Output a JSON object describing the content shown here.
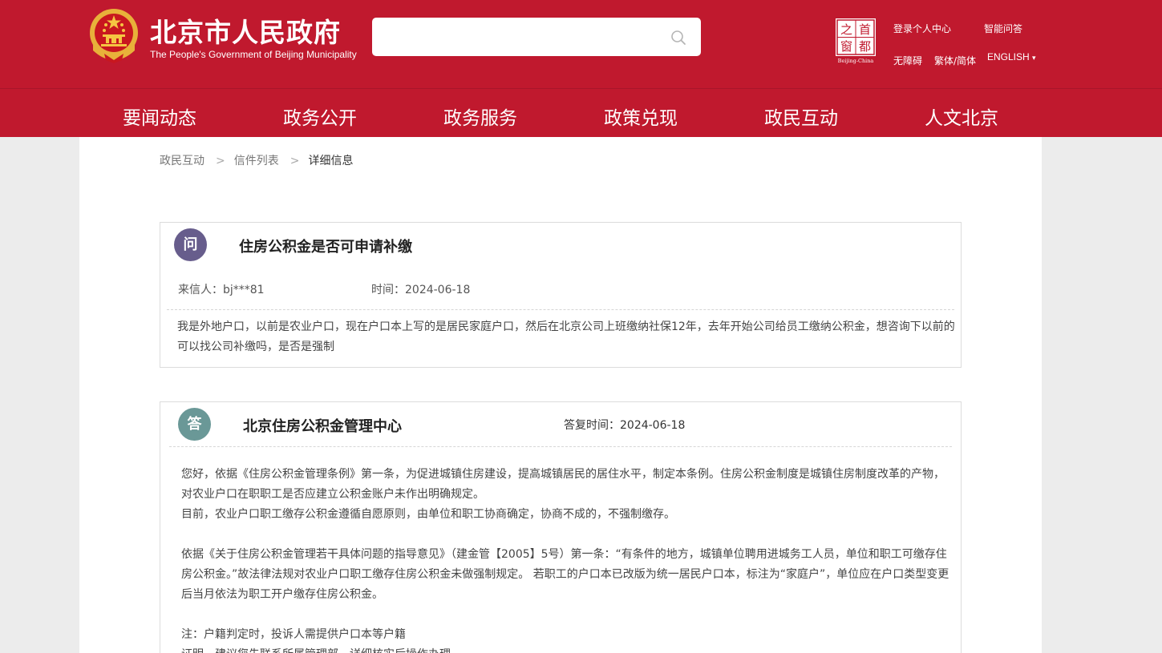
{
  "header": {
    "logo_cn": "北京市人民政府",
    "logo_en": "The People's Government of Beijing Municipality",
    "search_placeholder": "",
    "seal_chars": [
      "之",
      "首",
      "窗",
      "都"
    ],
    "seal_caption": "Beijing-China",
    "links": {
      "login": "登录个人中心",
      "qa": "智能问答",
      "accessibility": "无障碍",
      "traditional": "繁体/简体",
      "english": "ENGLISH",
      "english_caret": "▾"
    }
  },
  "nav": {
    "items": [
      "要闻动态",
      "政务公开",
      "政务服务",
      "政策兑现",
      "政民互动",
      "人文北京"
    ]
  },
  "breadcrumb": {
    "items": [
      "政民互动",
      "信件列表",
      "详细信息"
    ],
    "separator": ">"
  },
  "question": {
    "badge": "问",
    "title": "住房公积金是否可申请补缴",
    "sender": "来信人：bj***81",
    "time": "时间：2024-06-18",
    "body": "我是外地户口，以前是农业户口，现在户口本上写的是居民家庭户口，然后在北京公司上班缴纳社保12年，去年开始公司给员工缴纳公积金，想咨询下以前的可以找公司补缴吗，是否是强制"
  },
  "answer": {
    "badge": "答",
    "org": "北京住房公积金管理中心",
    "time": "答复时间：2024-06-18",
    "paragraphs": [
      "您好，依据《住房公积金管理条例》第一条，为促进城镇住房建设，提高城镇居民的居住水平，制定本条例。住房公积金制度是城镇住房制度改革的产物，对农业户口在职职工是否应建立公积金账户未作出明确规定。",
      "目前，农业户口职工缴存公积金遵循自愿原则，由单位和职工协商确定，协商不成的，不强制缴存。",
      "",
      "依据《关于住房公积金管理若干具体问题的指导意见》（建金管【2005】5号）第一条：“有条件的地方，城镇单位聘用进城务工人员，单位和职工可缴存住房公积金。”故法律法规对农业户口职工缴存住房公积金未做强制规定。 若职工的户口本已改版为统一居民户口本，标注为“家庭户”，单位应在户口类型变更后当月依法为职工开户缴存住房公积金。",
      "",
      "注：户籍判定时，投诉人需提供户口本等户籍",
      "证明，建议您先联系所属管理部，详细核实后操作办理。"
    ]
  },
  "colors": {
    "brand_red": "#c0192e",
    "question_badge": "#675d8c",
    "answer_badge": "#6a9897"
  }
}
